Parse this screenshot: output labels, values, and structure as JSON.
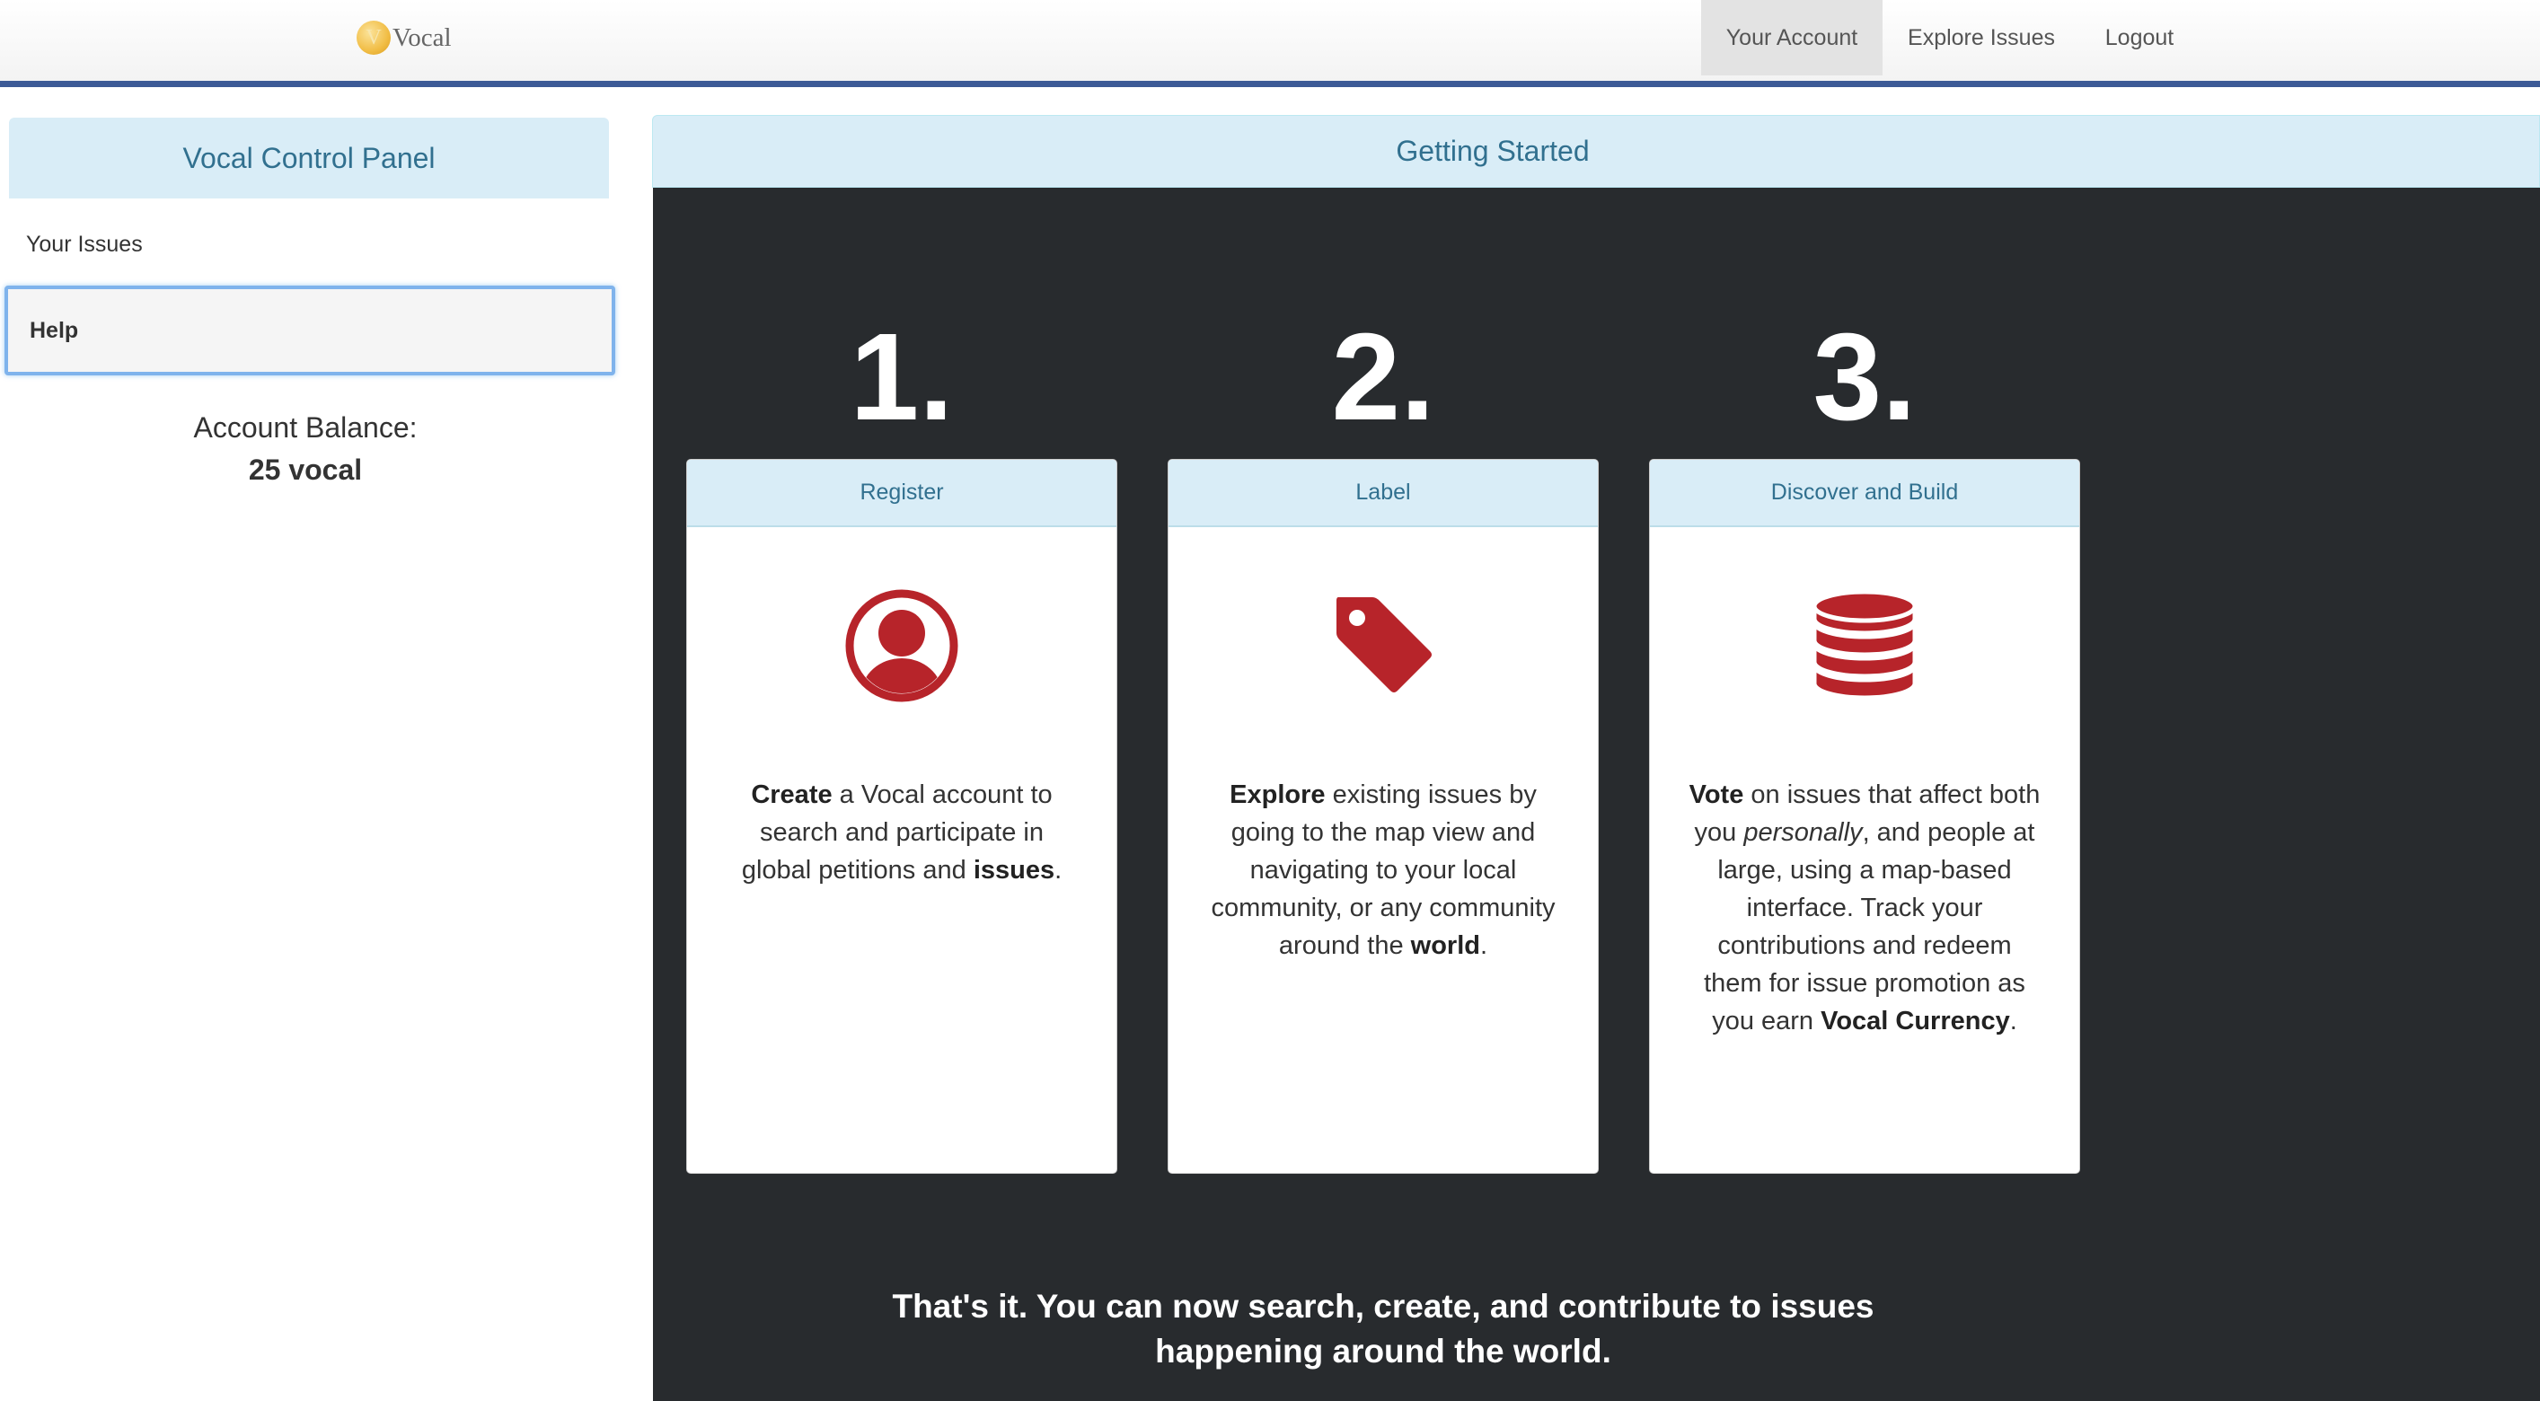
{
  "navbar": {
    "brand_initial": "V",
    "brand": "Vocal",
    "items": [
      {
        "label": "Your Account",
        "active": true
      },
      {
        "label": "Explore Issues",
        "active": false
      },
      {
        "label": "Logout",
        "active": false
      }
    ]
  },
  "sidebar": {
    "title": "Vocal Control Panel",
    "items": [
      {
        "label": "Your Issues",
        "active": false
      },
      {
        "label": "Help",
        "active": true
      }
    ],
    "balance_label": "Account Balance:",
    "balance_value": "25 vocal"
  },
  "main": {
    "title": "Getting Started",
    "steps": [
      {
        "number": "1.",
        "title": "Register",
        "icon": "user-circle-icon",
        "text": [
          {
            "t": "Create",
            "b": true
          },
          {
            "t": " a Vocal account to search and participate in global petitions and ",
            "b": false
          },
          {
            "t": "issues",
            "b": true
          },
          {
            "t": ".",
            "b": false
          }
        ]
      },
      {
        "number": "2.",
        "title": "Label",
        "icon": "tag-icon",
        "text": [
          {
            "t": "Explore",
            "b": true
          },
          {
            "t": " existing issues by going to the map view and navigating to your local community, or any community around the ",
            "b": false
          },
          {
            "t": "world",
            "b": true
          },
          {
            "t": ".",
            "b": false
          }
        ]
      },
      {
        "number": "3.",
        "title": "Discover and Build",
        "icon": "database-icon",
        "text": [
          {
            "t": "Vote",
            "b": true
          },
          {
            "t": " on issues that affect both you ",
            "b": false
          },
          {
            "t": "personally",
            "i": true
          },
          {
            "t": ", and people at large, using a map-based interface. Track your contributions and redeem them for issue promotion as you earn ",
            "b": false
          },
          {
            "t": "Vocal Currency",
            "b": true
          },
          {
            "t": ".",
            "b": false
          }
        ]
      }
    ],
    "footer": "That's it. You can now search, create, and contribute to issues happening around the world."
  },
  "colors": {
    "accent_blue": "#3c5a96",
    "panel_header": "#d9edf7",
    "panel_header_text": "#31708f",
    "dark_background": "#282b2e",
    "icon_red": "#b7242a"
  }
}
